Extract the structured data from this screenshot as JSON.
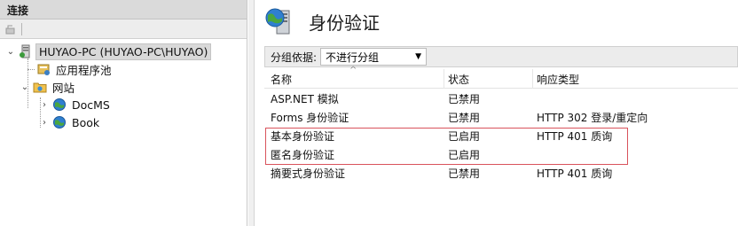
{
  "left_panel": {
    "title": "连接",
    "tree": {
      "server": {
        "label": "HUYAO-PC (HUYAO-PC\\HUYAO)",
        "expanded": true,
        "selected": true,
        "icon": "server-icon"
      },
      "app_pools": {
        "label": "应用程序池",
        "icon": "app-pool-icon"
      },
      "sites": {
        "label": "网站",
        "expanded": true,
        "icon": "sites-folder-icon",
        "children": [
          {
            "label": "DocMS",
            "icon": "globe-icon"
          },
          {
            "label": "Book",
            "icon": "globe-icon"
          }
        ]
      }
    }
  },
  "main": {
    "title": "身份验证",
    "icon": "authentication-icon",
    "group_by": {
      "label": "分组依据:",
      "value": "不进行分组"
    },
    "table": {
      "columns": [
        "名称",
        "状态",
        "响应类型"
      ],
      "rows": [
        {
          "name": "ASP.NET 模拟",
          "status": "已禁用",
          "response": ""
        },
        {
          "name": "Forms 身份验证",
          "status": "已禁用",
          "response": "HTTP 302 登录/重定向"
        },
        {
          "name": "基本身份验证",
          "status": "已启用",
          "response": "HTTP 401 质询"
        },
        {
          "name": "匿名身份验证",
          "status": "已启用",
          "response": ""
        },
        {
          "name": "摘要式身份验证",
          "status": "已禁用",
          "response": "HTTP 401 质询"
        }
      ]
    },
    "highlight_color": "#d9535c"
  }
}
